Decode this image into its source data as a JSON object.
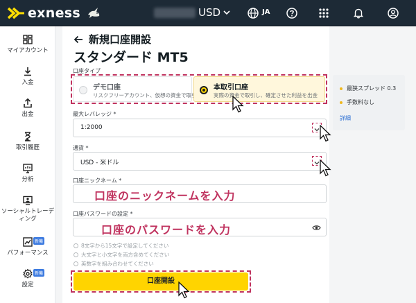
{
  "header": {
    "brand": "exness",
    "currency": "USD",
    "language": "JA",
    "icons": [
      "globe-icon",
      "help-icon",
      "apps-icon",
      "bell-icon",
      "account-icon"
    ]
  },
  "sidebar": {
    "items": [
      {
        "label": "マイアカウント",
        "icon": "dashboard-icon"
      },
      {
        "label": "入金",
        "icon": "deposit-icon"
      },
      {
        "label": "出金",
        "icon": "withdraw-icon"
      },
      {
        "label": "取引履歴",
        "icon": "hourglass-icon"
      },
      {
        "label": "分析",
        "icon": "analytics-icon"
      },
      {
        "label": "ソーシャルトレーディング",
        "icon": "social-trading-icon"
      },
      {
        "label": "パフォーマンス",
        "icon": "performance-icon",
        "badge": "新機"
      },
      {
        "label": "設定",
        "icon": "settings-icon",
        "badge": "新機"
      }
    ]
  },
  "form": {
    "page_title": "新規口座開設",
    "subtitle": "スタンダード MT5",
    "account_type_label": "口座タイプ",
    "account_types": [
      {
        "title": "デモ口座",
        "desc": "リスクフリーアカウント、仮想の資金で取引",
        "selected": false
      },
      {
        "title": "本取引口座",
        "desc": "実際の資金で取引し、確定させた利益を出金",
        "selected": true
      }
    ],
    "leverage_label": "最大レバレッジ *",
    "leverage_value": "1:2000",
    "currency_label": "通貨 *",
    "currency_value": "USD - 米ドル",
    "nickname_label": "口座ニックネーム *",
    "nickname_overlay": "口座のニックネームを入力",
    "password_label": "口座パスワードの設定 *",
    "password_overlay": "口座のパスワードを入力",
    "password_rules": [
      "8文字から15文字で設定してください",
      "大文字と小文字を両方含めてください",
      "英数字を組み合わせてください"
    ],
    "submit_label": "口座開設"
  },
  "info_panel": {
    "items": [
      "最狭スプレッド 0.3",
      "手数料なし"
    ],
    "link": "詳細"
  },
  "colors": {
    "accent": "#ffd400",
    "annotation": "#c0335f",
    "header_bg": "#1d2a36"
  }
}
